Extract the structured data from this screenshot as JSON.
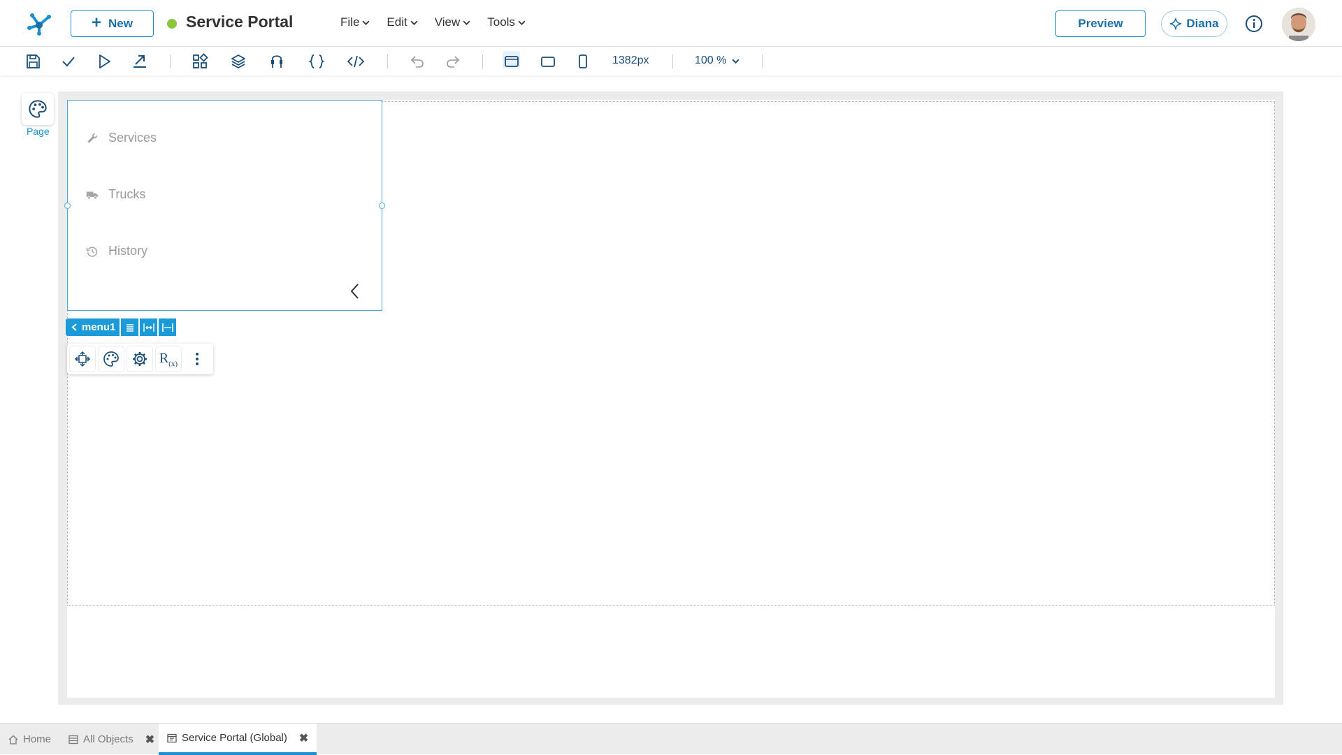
{
  "header": {
    "new_label": "New",
    "app_title": "Service Portal",
    "status_color": "#8cc63f",
    "menus": [
      "File",
      "Edit",
      "View",
      "Tools"
    ],
    "preview_label": "Preview",
    "assistant_label": "Diana"
  },
  "toolbar": {
    "width_value": "1382px",
    "zoom_value": "100 %"
  },
  "rail": {
    "page_label": "Page"
  },
  "menu_component": {
    "items": [
      {
        "label": "Services",
        "icon": "wrench-icon"
      },
      {
        "label": "Trucks",
        "icon": "truck-icon"
      },
      {
        "label": "History",
        "icon": "history-icon"
      }
    ],
    "name": "menu1"
  },
  "context": {
    "rx_label": "R",
    "rx_sub": "(x)"
  },
  "tabs": [
    {
      "label": "Home"
    },
    {
      "label": "All Objects"
    },
    {
      "label": "Service Portal (Global)"
    }
  ],
  "colors": {
    "accent": "#1b8fcf",
    "selection": "#4ba9da"
  }
}
